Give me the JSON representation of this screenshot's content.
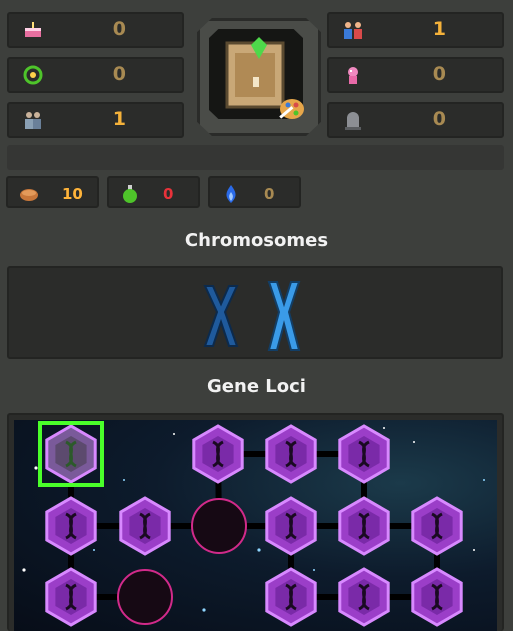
{
  "stats_left": [
    {
      "icon": "cake-icon",
      "value": "0"
    },
    {
      "icon": "laurel-wreath-icon",
      "value": "0"
    },
    {
      "icon": "people-icon",
      "value": "1"
    }
  ],
  "stats_right": [
    {
      "icon": "family-icon",
      "value": "1"
    },
    {
      "icon": "pink-creature-icon",
      "value": "0"
    },
    {
      "icon": "gravestone-icon",
      "value": "0"
    }
  ],
  "portrait": {
    "icon": "card-with-gem-icon",
    "overlay": "palette-brush-icon"
  },
  "resources": [
    {
      "icon": "bread-icon",
      "value": "10"
    },
    {
      "icon": "green-potion-icon",
      "value": "0"
    },
    {
      "icon": "blue-flame-icon",
      "value": "0"
    }
  ],
  "sections": {
    "chromosomes_title": "Chromosomes",
    "gene_loci_title": "Gene Loci"
  },
  "chromosomes": [
    {
      "icon": "chromosome-x-dark-icon",
      "color": "#1f5a9c"
    },
    {
      "icon": "chromosome-x-light-icon",
      "color": "#3a9be8"
    }
  ],
  "gene_loci": {
    "hex_color": "#9b3ec8",
    "orb_color": "#160914",
    "selected_color": "#4aff2a",
    "nodes": [
      {
        "kind": "hex",
        "state": "selected"
      },
      {
        "kind": "hex",
        "state": "normal"
      },
      {
        "kind": "hex",
        "state": "normal"
      },
      {
        "kind": "hex",
        "state": "normal"
      },
      {
        "kind": "hex",
        "state": "normal"
      },
      {
        "kind": "hex",
        "state": "normal"
      },
      {
        "kind": "orb",
        "state": "normal"
      },
      {
        "kind": "hex",
        "state": "normal"
      },
      {
        "kind": "hex",
        "state": "normal"
      },
      {
        "kind": "hex",
        "state": "normal"
      },
      {
        "kind": "hex",
        "state": "normal"
      },
      {
        "kind": "orb",
        "state": "normal"
      },
      {
        "kind": "hex",
        "state": "normal"
      },
      {
        "kind": "hex",
        "state": "normal"
      },
      {
        "kind": "hex",
        "state": "normal"
      }
    ]
  }
}
